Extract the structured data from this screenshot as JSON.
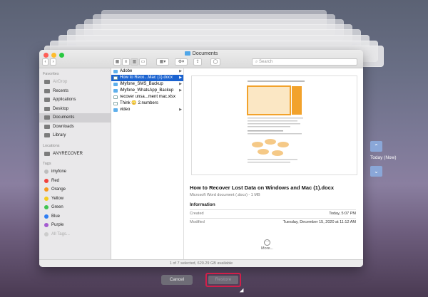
{
  "window": {
    "title": "Documents",
    "search_placeholder": "Search",
    "status": "1 of 7 selected, 620.29 GB available"
  },
  "sidebar": {
    "favorites_header": "Favorites",
    "favorites": [
      {
        "label": "AirDrop",
        "icon": "airdrop-icon",
        "dim": true
      },
      {
        "label": "Recents",
        "icon": "clock-icon"
      },
      {
        "label": "Applications",
        "icon": "applications-icon"
      },
      {
        "label": "Desktop",
        "icon": "desktop-icon"
      },
      {
        "label": "Documents",
        "icon": "document-icon",
        "selected": true
      },
      {
        "label": "Downloads",
        "icon": "download-icon"
      },
      {
        "label": "Library",
        "icon": "folder-icon"
      }
    ],
    "locations_header": "Locations",
    "locations": [
      {
        "label": "ANYRECOVER",
        "icon": "drive-icon"
      }
    ],
    "tags_header": "Tags",
    "tags": [
      {
        "label": "imyfone",
        "color": "#bdbdbd"
      },
      {
        "label": "Red",
        "color": "#f0413d"
      },
      {
        "label": "Orange",
        "color": "#f59a1f"
      },
      {
        "label": "Yellow",
        "color": "#f5cc1f"
      },
      {
        "label": "Green",
        "color": "#40c451"
      },
      {
        "label": "Blue",
        "color": "#2f7ef3"
      },
      {
        "label": "Purple",
        "color": "#a45bd0"
      },
      {
        "label": "All Tags...",
        "color": "#cccccc",
        "dim": true
      }
    ]
  },
  "files": [
    {
      "name": "Adobe",
      "type": "folder",
      "chevron": true
    },
    {
      "name": "How to Reco...Mac (1).docx",
      "type": "doc",
      "selected": true,
      "chevron": true
    },
    {
      "name": "iMyfone_SMS_Backup",
      "type": "folder",
      "chevron": true
    },
    {
      "name": "iMyfone_WhatsApp_Backup",
      "type": "folder",
      "chevron": true
    },
    {
      "name": "recover unsa...ment mac.xlsx",
      "type": "doc"
    },
    {
      "name": "Think 😳 2.numbers",
      "type": "doc"
    },
    {
      "name": "video",
      "type": "folder",
      "chevron": true
    }
  ],
  "preview": {
    "title": "How to Recover Lost Data on Windows and Mac (1).docx",
    "subtitle": "Microsoft Word document (.docx) - 1 MB",
    "info_header": "Information",
    "created_label": "Created",
    "created_value": "Today, 5:07 PM",
    "modified_label": "Modified",
    "modified_value": "Tuesday, December 15, 2020 at 11:12 AM",
    "more_label": "More..."
  },
  "buttons": {
    "cancel": "Cancel",
    "restore": "Restore"
  },
  "timeline": {
    "label": "Today (Now)"
  },
  "colors": {
    "accent": "#1b63d0",
    "highlight": "#d21f4a"
  }
}
